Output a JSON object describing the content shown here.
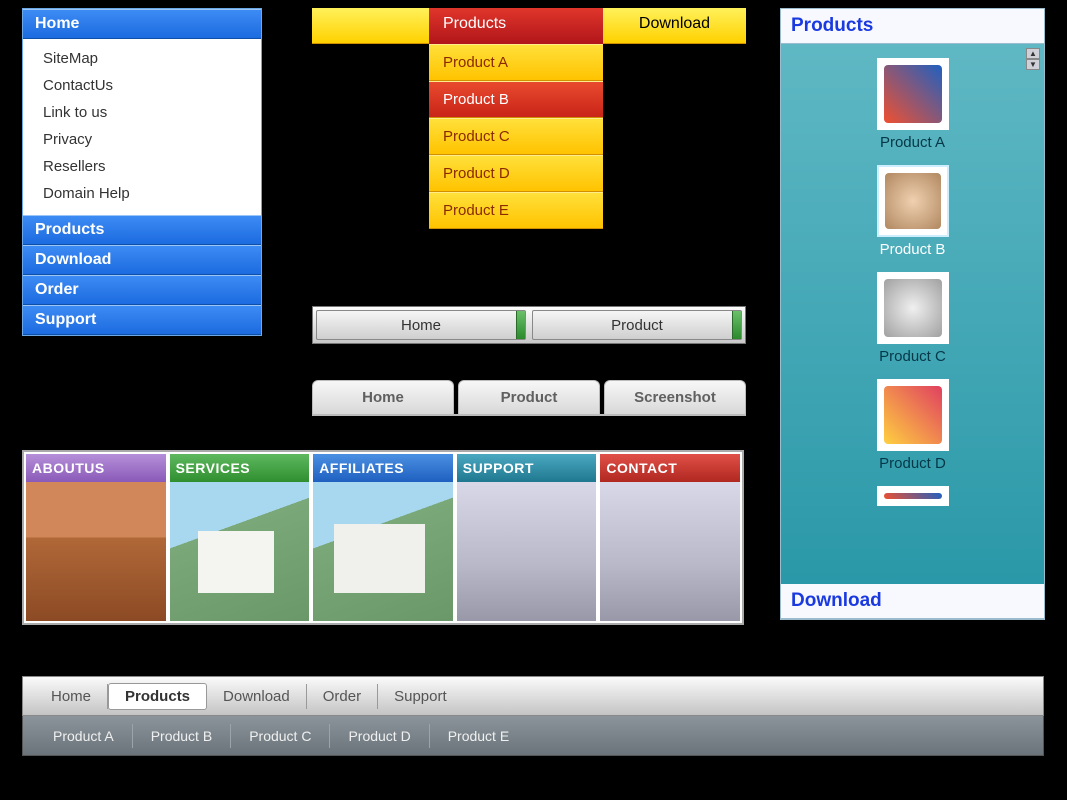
{
  "vmenu": {
    "headers": [
      "Home",
      "Products",
      "Download",
      "Order",
      "Support"
    ],
    "home_items": [
      "SiteMap",
      "ContactUs",
      "Link to us",
      "Privacy",
      "Resellers",
      "Domain Help"
    ]
  },
  "topbar": {
    "products": "Products",
    "download": "Download",
    "dropdown": [
      "Product   A",
      "Product   B",
      "Product   C",
      "Product   D",
      "Product   E"
    ],
    "active_index": 1
  },
  "silverbar": [
    "Home",
    "Product"
  ],
  "tabstrip": [
    "Home",
    "Product",
    "Screenshot"
  ],
  "cards": [
    {
      "label": "ABOUTUS",
      "color": "purple"
    },
    {
      "label": "SERVICES",
      "color": "green"
    },
    {
      "label": "AFFILIATES",
      "color": "blue"
    },
    {
      "label": "SUPPORT",
      "color": "teal"
    },
    {
      "label": "CONTACT",
      "color": "red"
    }
  ],
  "rightpanel": {
    "title": "Products",
    "items": [
      "Product A",
      "Product B",
      "Product C",
      "Product D"
    ],
    "selected_index": 1,
    "footer": "Download"
  },
  "bottombar": {
    "row1": [
      "Home",
      "Products",
      "Download",
      "Order",
      "Support"
    ],
    "row1_active": 1,
    "row2": [
      "Product  A",
      "Product  B",
      "Product  C",
      "Product  D",
      "Product  E"
    ]
  }
}
